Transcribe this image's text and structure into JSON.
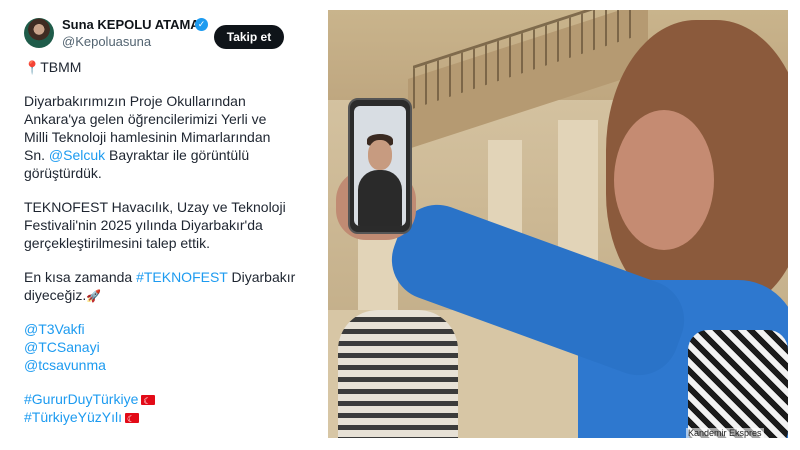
{
  "tweet": {
    "author_name": "Suna KEPOLU ATAMA",
    "handle": "@Kepoluasuna",
    "follow_label": "Takip et",
    "location_tag": "TBMM",
    "lines": [
      {
        "pre": "Diyarbakırımızın Proje Okullarından",
        "link": "",
        "post": ""
      },
      {
        "pre": "Ankara'ya gelen öğrencilerimizi Yerli ve",
        "link": "",
        "post": ""
      },
      {
        "pre": "Milli Teknoloji hamlesinin Mimarlarından",
        "link": "",
        "post": ""
      },
      {
        "pre": "Sn. ",
        "link": "@Selcuk",
        "post": " Bayraktar ile görüntülü"
      },
      {
        "pre": "görüştürdük.",
        "link": "",
        "post": ""
      }
    ],
    "lines2": [
      "TEKNOFEST Havacılık, Uzay ve Teknoloji",
      "Festivali'nin 2025 yılında Diyarbakır'da",
      "gerçekleştirilmesini talep ettik."
    ],
    "line3a_pre": "En kısa zamanda ",
    "line3a_link": "#TEKNOFEST",
    "line3a_post": " Diyarbakır",
    "line3b": "diyeceğiz.",
    "mentions": [
      "@T3Vakfi",
      "@TCSanayi",
      "@tcsavunma"
    ],
    "hashtags": [
      "#GururDuyTürkiye",
      "#TürkiyeYüzYılı"
    ]
  },
  "photo": {
    "watermark": "Kandemir Ekspres"
  },
  "icons": {
    "verified": "verified-badge-icon",
    "pin": "pin-icon",
    "rocket": "rocket-icon",
    "flag": "turkish-flag-icon"
  },
  "colors": {
    "link": "#1d9bf0",
    "button": "#0f1419",
    "coat": "#2e78cf"
  }
}
